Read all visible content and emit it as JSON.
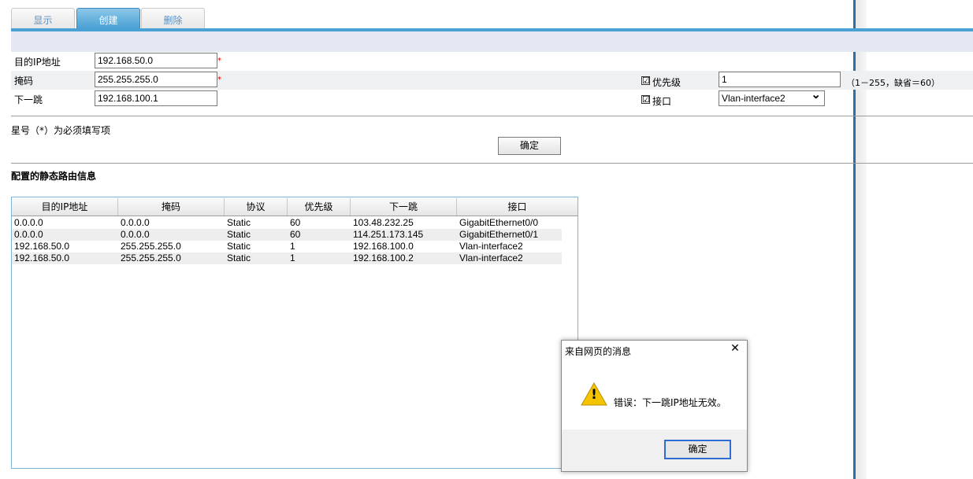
{
  "tabs": [
    {
      "label": "显示"
    },
    {
      "label": "创建"
    },
    {
      "label": "删除"
    }
  ],
  "form": {
    "dest_ip": {
      "label": "目的IP地址",
      "value": "192.168.50.0",
      "required_mark": "*"
    },
    "mask": {
      "label": "掩码",
      "value": "255.255.255.0",
      "required_mark": "*"
    },
    "next_hop": {
      "label": "下一跳",
      "value": "192.168.100.1"
    },
    "priority": {
      "label": "优先级",
      "checked": "☑",
      "value": "1",
      "hint": "（1－255，缺省＝60）"
    },
    "interface": {
      "label": "接口",
      "checked": "☑",
      "value": "Vlan-interface2",
      "caret": "⌄"
    },
    "required_note": "星号（*）为必须填写项",
    "confirm_label": "确定"
  },
  "table": {
    "title": "配置的静态路由信息",
    "columns": [
      "目的IP地址",
      "掩码",
      "协议",
      "优先级",
      "下一跳",
      "接口"
    ],
    "rows": [
      [
        "0.0.0.0",
        "0.0.0.0",
        "Static",
        "60",
        "103.48.232.25",
        "GigabitEthernet0/0"
      ],
      [
        "0.0.0.0",
        "0.0.0.0",
        "Static",
        "60",
        "114.251.173.145",
        "GigabitEthernet0/1"
      ],
      [
        "192.168.50.0",
        "255.255.255.0",
        "Static",
        "1",
        "192.168.100.0",
        "Vlan-interface2"
      ],
      [
        "192.168.50.0",
        "255.255.255.0",
        "Static",
        "1",
        "192.168.100.2",
        "Vlan-interface2"
      ]
    ]
  },
  "dialog": {
    "title": "来自网页的消息",
    "close_glyph": "✕",
    "icon": "warning-icon",
    "icon_glyph": "!",
    "message": "错误：下一跳IP地址无效。",
    "ok_label": "确定"
  },
  "colors": {
    "tab_active": "#4aa1d4",
    "frame": "#2f6ea5",
    "warning": "#f5c400",
    "required": "#dd0000"
  }
}
